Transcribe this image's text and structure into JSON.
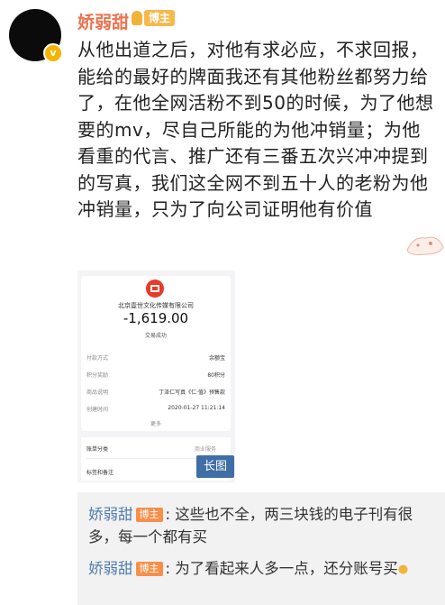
{
  "post": {
    "username": "娇弱甜",
    "badge": "博主",
    "avatar_badge": "v",
    "text": "从他出道之后，对他有求必应，不求回报，能给的最好的牌面我还有其他粉丝都努力给了，在他全网活粉不到50的时候，为了他想要的mv，尽自己所能的为他冲销量；为他看重的代言、推广还有三番五次兴冲冲提到的写真，我们这全网不到五十人的老粉为他冲销量，只为了向公司证明他有价值"
  },
  "receipt": {
    "merchant": "北京壹世文化传媒有限公司",
    "amount": "-1,619.00",
    "status": "交易成功",
    "rows": [
      {
        "label": "付款方式",
        "value": "余额宝"
      },
      {
        "label": "积分奖励",
        "value": "80积分"
      },
      {
        "label": "商品说明",
        "value": "丁泽仁写真《仁·值》预售款"
      },
      {
        "label": "创建时间",
        "value": "2020-01-27 11:21:14"
      }
    ],
    "more": "更多",
    "bill_category_label": "账单分类",
    "bill_category_value": "商业服务",
    "tags_label": "标签和备注",
    "long_image_badge": "长图"
  },
  "comments": [
    {
      "user": "娇弱甜",
      "badge": "博主",
      "text": ": 这些也不全，两三块钱的电子刊有很多，每一个都有买"
    },
    {
      "user": "娇弱甜",
      "badge": "博主",
      "text": ": 为了看起来人多一点，还分账号买"
    }
  ],
  "icons": [
    "avatar",
    "verified-icon",
    "crown-icon",
    "merchant-icon",
    "lightbulb-icon",
    "sticker-icon"
  ],
  "colors": {
    "username": "#eb7350",
    "comment_user": "#507daf",
    "badge": "#f78f4b",
    "long_badge": "#3f6fa5"
  }
}
